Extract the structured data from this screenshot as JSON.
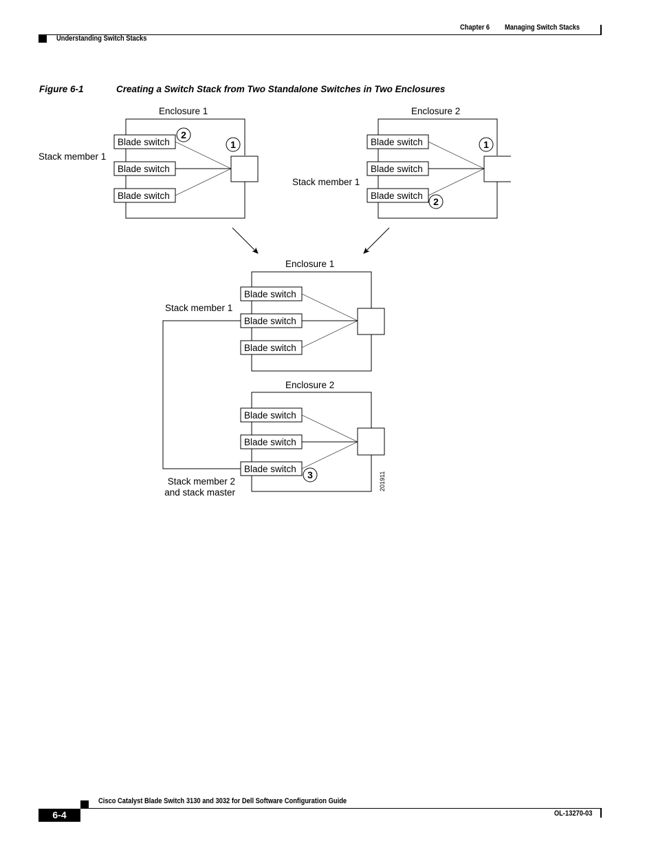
{
  "header": {
    "chapter_label": "Chapter 6",
    "chapter_title": "Managing Switch Stacks",
    "section_title": "Understanding Switch Stacks"
  },
  "figure": {
    "number_label": "Figure 6-1",
    "caption": "Creating a Switch Stack from Two Standalone Switches in Two Enclosures",
    "top_left": {
      "enclosure_label": "Enclosure 1",
      "member_label": "Stack member 1",
      "switches": [
        "Blade switch",
        "Blade switch",
        "Blade switch"
      ],
      "callouts": [
        "2",
        "1"
      ]
    },
    "top_right": {
      "enclosure_label": "Enclosure 2",
      "member_label": "Stack member 1",
      "switches": [
        "Blade switch",
        "Blade switch",
        "Blade switch"
      ],
      "callouts": [
        "1",
        "2"
      ]
    },
    "bottom_upper": {
      "enclosure_label": "Enclosure 1",
      "member_label": "Stack member 1",
      "switches": [
        "Blade switch",
        "Blade switch",
        "Blade switch"
      ]
    },
    "bottom_lower": {
      "enclosure_label": "Enclosure 2",
      "member_label_line1": "Stack member 2",
      "member_label_line2": "and stack master",
      "switches": [
        "Blade switch",
        "Blade switch",
        "Blade switch"
      ],
      "callouts": [
        "3"
      ]
    },
    "art_id": "201911"
  },
  "footer": {
    "guide_title": "Cisco Catalyst Blade Switch 3130 and 3032 for Dell Software Configuration Guide",
    "page_number": "6-4",
    "doc_id": "OL-13270-03"
  }
}
